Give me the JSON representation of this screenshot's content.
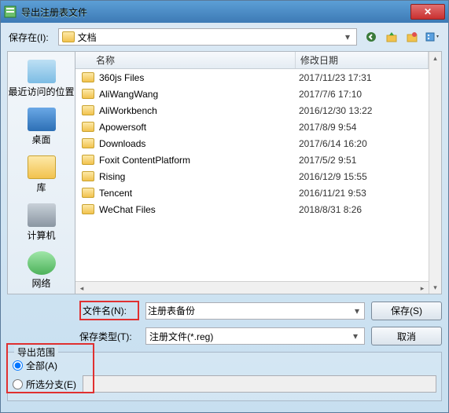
{
  "window": {
    "title": "导出注册表文件",
    "close": "✕"
  },
  "toolbar": {
    "savein_label": "保存在(I):",
    "location": "文档",
    "icons": {
      "back": "←",
      "up": "↑",
      "newfolder": "📁",
      "views": "☰"
    }
  },
  "places": {
    "recent": "最近访问的位置",
    "desktop": "桌面",
    "library": "库",
    "computer": "计算机",
    "network": "网络"
  },
  "columns": {
    "name": "名称",
    "date": "修改日期"
  },
  "files": [
    {
      "name": "360js Files",
      "date": "2017/11/23 17:31"
    },
    {
      "name": "AliWangWang",
      "date": "2017/7/6 17:10"
    },
    {
      "name": "AliWorkbench",
      "date": "2016/12/30 13:22"
    },
    {
      "name": "Apowersoft",
      "date": "2017/8/9 9:54"
    },
    {
      "name": "Downloads",
      "date": "2017/6/14 16:20"
    },
    {
      "name": "Foxit ContentPlatform",
      "date": "2017/5/2 9:51"
    },
    {
      "name": "Rising",
      "date": "2016/12/9 15:55"
    },
    {
      "name": "Tencent",
      "date": "2016/11/21 9:53"
    },
    {
      "name": "WeChat Files",
      "date": "2018/8/31 8:26"
    }
  ],
  "inputs": {
    "filename_label": "文件名(N):",
    "filename_value": "注册表备份",
    "filetype_label": "保存类型(T):",
    "filetype_value": "注册文件(*.reg)"
  },
  "buttons": {
    "save": "保存(S)",
    "cancel": "取消"
  },
  "range": {
    "legend": "导出范围",
    "all": "全部(A)",
    "branch": "所选分支(E)"
  }
}
